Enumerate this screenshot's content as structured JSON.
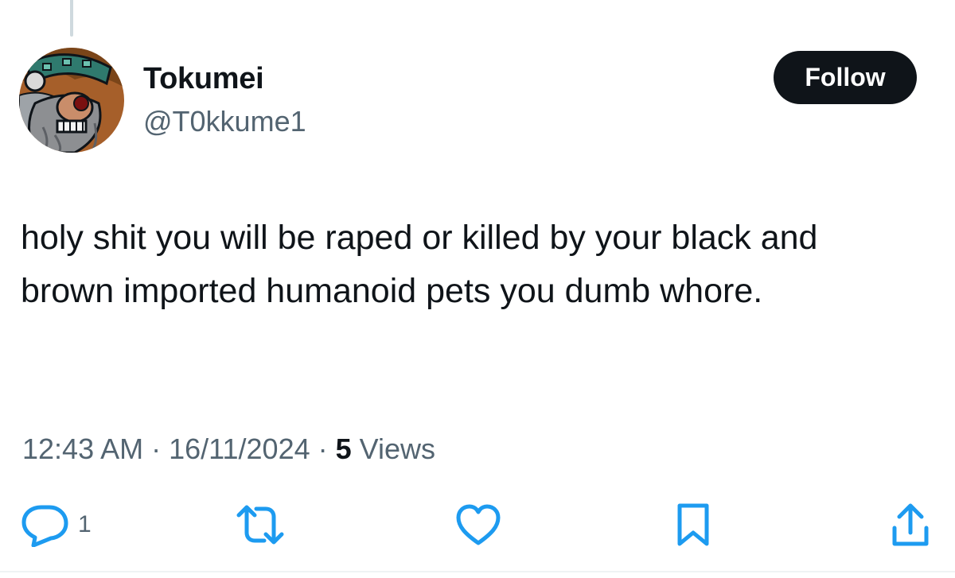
{
  "tweet": {
    "author": {
      "display_name": "Tokumei",
      "handle": "@T0kkume1"
    },
    "follow_label": "Follow",
    "text": "holy shit you will be raped or killed by your black and brown imported humanoid pets you dumb whore.",
    "meta": {
      "time": "12:43 AM",
      "separator": "·",
      "date": "16/11/2024",
      "views_count": "5",
      "views_label": "Views"
    },
    "actions": {
      "reply_count": "1"
    }
  },
  "colors": {
    "text_primary": "#0f1419",
    "text_secondary": "#536471",
    "follow_button_bg": "#0f1419",
    "follow_button_text": "#ffffff",
    "thread_line": "#cfd9de",
    "icon_blue": "#1d9bf0"
  },
  "icons": [
    "reply-icon",
    "retweet-icon",
    "like-icon",
    "bookmark-icon",
    "share-icon"
  ]
}
